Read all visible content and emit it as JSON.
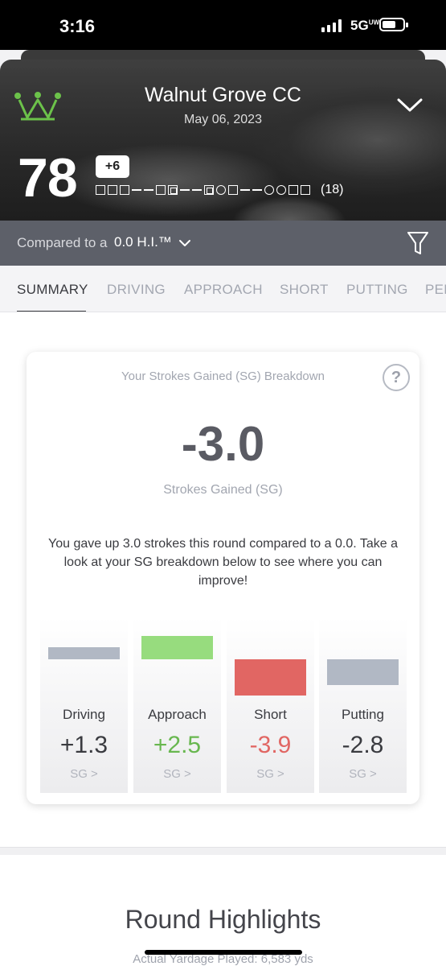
{
  "status_bar": {
    "time": "3:16",
    "network": "5G",
    "network_sup": "UW"
  },
  "header": {
    "course_name": "Walnut Grove CC",
    "date": "May 06, 2023",
    "score": "78",
    "to_par": "+6",
    "hole_count": "(18)",
    "hole_symbols": [
      "square",
      "square",
      "square",
      "dash",
      "dash",
      "square",
      "double-square",
      "dash",
      "dash",
      "double-square",
      "circle",
      "square",
      "dash",
      "dash",
      "circle",
      "circle",
      "square",
      "square"
    ]
  },
  "compare": {
    "label": "Compared to a",
    "value": "0.0 H.I.™"
  },
  "tabs": [
    {
      "label": "SUMMARY",
      "active": true
    },
    {
      "label": "DRIVING",
      "active": false
    },
    {
      "label": "APPROACH",
      "active": false
    },
    {
      "label": "SHORT",
      "active": false
    },
    {
      "label": "PUTTING",
      "active": false
    },
    {
      "label": "PER",
      "active": false
    }
  ],
  "card": {
    "title": "Your Strokes Gained (SG) Breakdown",
    "help_label": "?",
    "total": "-3.0",
    "total_label": "Strokes Gained (SG)",
    "description": "You gave up 3.0 strokes this round compared to a 0.0. Take a look at your SG breakdown below to see where you can improve!",
    "categories": [
      {
        "name": "Driving",
        "value": "+1.3",
        "link": "SG >",
        "numeric": 1.3,
        "color": "#b1b8c4",
        "text_color": "#3a3b40"
      },
      {
        "name": "Approach",
        "value": "+2.5",
        "link": "SG >",
        "numeric": 2.5,
        "color": "#97dc7e",
        "text_color": "#68b74f"
      },
      {
        "name": "Short",
        "value": "-3.9",
        "link": "SG >",
        "numeric": -3.9,
        "color": "#e16663",
        "text_color": "#e16663"
      },
      {
        "name": "Putting",
        "value": "-2.8",
        "link": "SG >",
        "numeric": -2.8,
        "color": "#b1b8c4",
        "text_color": "#3a3b40"
      }
    ]
  },
  "highlights": {
    "title": "Round Highlights",
    "subtitle": "Actual Yardage Played: 6,583 yds"
  }
}
